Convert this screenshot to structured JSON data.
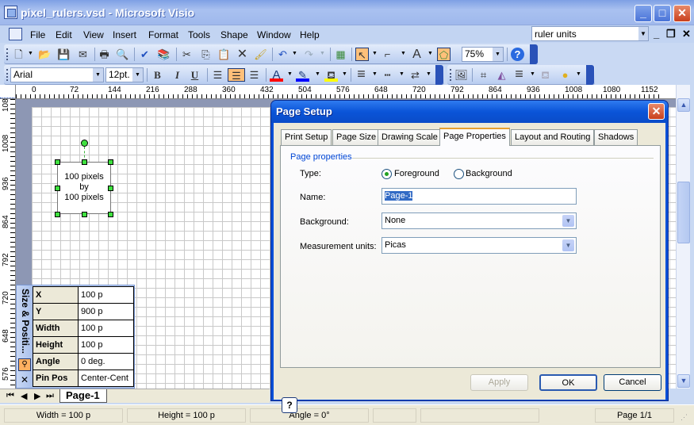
{
  "window": {
    "title": "pixel_rulers.vsd - Microsoft Visio",
    "minimize": "_",
    "maximize": "□",
    "close": "✕"
  },
  "menu": {
    "items": [
      "File",
      "Edit",
      "View",
      "Insert",
      "Format",
      "Tools",
      "Shape",
      "Window",
      "Help"
    ],
    "help_search": "ruler units",
    "mdi_min": "_",
    "mdi_restore": "❐",
    "mdi_close": "✕"
  },
  "toolbar": {
    "zoom": "75%",
    "font": "Arial",
    "font_size": "12pt.",
    "bold": "B",
    "italic": "I",
    "underline": "U",
    "icons": [
      "new-icon",
      "open-icon",
      "save-icon",
      "send-icon",
      "print-icon",
      "print-preview-icon",
      "spelling-icon",
      "research-icon",
      "cut-icon",
      "copy-icon",
      "paste-icon",
      "delete-icon",
      "format-painter-icon",
      "undo-icon",
      "redo-icon",
      "shapes-icon",
      "pointer-tool-icon",
      "connector-tool-icon",
      "text-tool-icon",
      "drawing-tool-icon",
      "help-icon"
    ],
    "colors": {
      "font": "#ff0000",
      "line": "#0000ff",
      "fill": "#ffff00",
      "highlight": "#ffc07a"
    }
  },
  "rulers": {
    "horizontal": [
      "0",
      "72",
      "144",
      "216",
      "288",
      "360",
      "432",
      "504",
      "576",
      "648",
      "720",
      "792",
      "864",
      "936",
      "1008",
      "1080",
      "1152"
    ],
    "vertical": [
      "108",
      "1008",
      "936",
      "864",
      "792",
      "720",
      "648",
      "576"
    ]
  },
  "shape": {
    "line1": "100 pixels",
    "line2": "by",
    "line3": "100 pixels"
  },
  "size_position": {
    "title": "Size & Positi...",
    "rows": [
      {
        "key": "X",
        "value": "100 p"
      },
      {
        "key": "Y",
        "value": "900 p"
      },
      {
        "key": "Width",
        "value": "100 p"
      },
      {
        "key": "Height",
        "value": "100 p"
      },
      {
        "key": "Angle",
        "value": "0 deg."
      },
      {
        "key": "Pin Pos",
        "value": "Center-Cent"
      }
    ]
  },
  "page_tabs": {
    "active": "Page-1"
  },
  "status": {
    "width": "Width = 100 p",
    "height": "Height = 100 p",
    "angle": "Angle = 0°",
    "page": "Page 1/1"
  },
  "dialog": {
    "title": "Page Setup",
    "tabs": [
      "Print Setup",
      "Page Size",
      "Drawing Scale",
      "Page Properties",
      "Layout and Routing",
      "Shadows"
    ],
    "active_tab": "Page Properties",
    "group": "Page properties",
    "type_label": "Type:",
    "type_options": [
      "Foreground",
      "Background"
    ],
    "type_selected": "Foreground",
    "name_label": "Name:",
    "name_value": "Page-1",
    "background_label": "Background:",
    "background_value": "None",
    "units_label": "Measurement units:",
    "units_value": "Picas",
    "buttons": {
      "apply": "Apply",
      "ok": "OK",
      "cancel": "Cancel"
    },
    "help": "?"
  }
}
